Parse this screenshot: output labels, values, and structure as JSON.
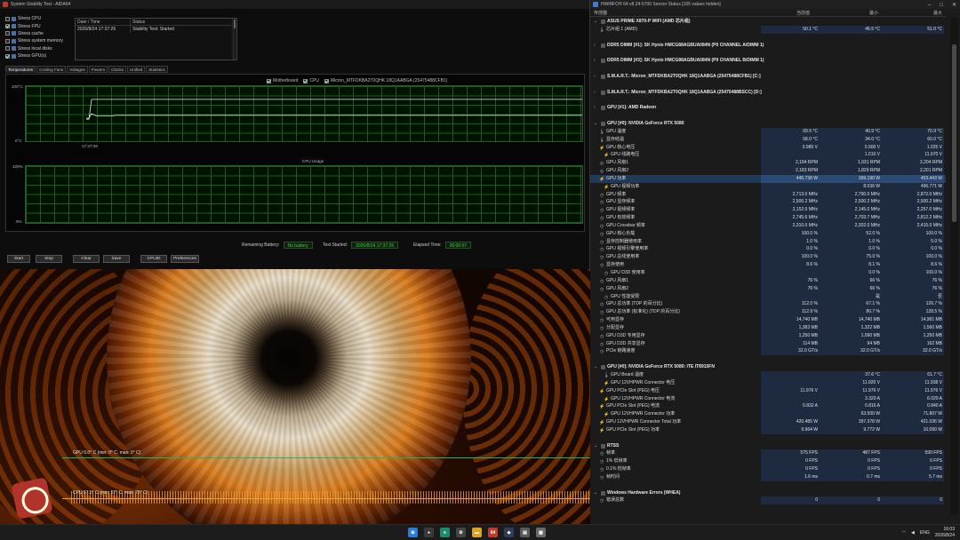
{
  "aida": {
    "title": "System Stability Test - AIDA64",
    "stress_items": [
      {
        "label": "Stress CPU",
        "checked": false
      },
      {
        "label": "Stress FPU",
        "checked": true
      },
      {
        "label": "Stress cache",
        "checked": false
      },
      {
        "label": "Stress system memory",
        "checked": false
      },
      {
        "label": "Stress local disks",
        "checked": false
      },
      {
        "label": "Stress GPU(s)",
        "checked": true
      }
    ],
    "status_table": {
      "col_datetime": "Date / Time",
      "col_status": "Status",
      "row_datetime": "2026/8/24 17:37:26",
      "row_status": "Stability Test: Started"
    },
    "tabs": [
      "Temperatures",
      "Cooling Fans",
      "Voltages",
      "Powers",
      "Clocks",
      "Unified",
      "Statistics"
    ],
    "active_tab": "Temperatures",
    "legend": [
      "Motherboard",
      "CPU",
      "Micron_MTFDKBA2T0QHK 18Q1AABGA (25475488CFB1)"
    ],
    "temp_axis_top": "100°C",
    "temp_axis_bottom": "0°C",
    "temp_time_label": "17:37:26",
    "temperature_series": {
      "note": "relative level per column, 0 = 0°C, 1 = 100°C",
      "line_a": [
        0.42,
        0.42,
        0.5,
        0.46,
        0.46,
        0.46,
        0.46,
        0.47,
        0.47,
        0.47,
        0.47,
        0.47,
        0.47,
        0.47,
        0.47,
        0.47,
        0.47,
        0.47,
        0.47,
        0.47
      ],
      "line_b": [
        0.4,
        0.4,
        0.76,
        0.76,
        0.76,
        0.76,
        0.76,
        0.76,
        0.76,
        0.76,
        0.76,
        0.76,
        0.76,
        0.76,
        0.76,
        0.76,
        0.76,
        0.76,
        0.76,
        0.76
      ]
    },
    "cpu_graph_title": "CPU Usage",
    "cpu_axis_top": "100%",
    "cpu_axis_bottom": "0%",
    "remaining_battery_label": "Remaining Battery:",
    "remaining_battery_value": "No battery",
    "test_started_label": "Test Started:",
    "test_started_value": "2026/8/24 17:37:26",
    "elapsed_label": "Elapsed Time:",
    "elapsed_value": "00:00:07",
    "buttons": {
      "start": "Start",
      "stop": "Stop",
      "clear": "Clear",
      "save": "Save",
      "cpuid": "CPUID",
      "preferences": "Preferences"
    }
  },
  "osd": {
    "gpu_line": "GPU 0.0° C (min: 0° C, max: 0° C)",
    "cpu_line": "CPU 57.0° C (min: 57° C, max: 78° C)"
  },
  "hwinfo": {
    "title": "HWiNFO® 64 v8.24-5700 Sensor Status [105 values hidden]",
    "window_buttons": {
      "minimize": "–",
      "maximize": "□",
      "close": "✕"
    },
    "columns": {
      "sensor": "传感器",
      "current": "当前值",
      "min": "最小",
      "max": "最大"
    },
    "rows": [
      {
        "kind": "group",
        "name": "ASUS PRIME X870-P WIFI (AMD 芯片组)"
      },
      {
        "kind": "sensor",
        "icon": "thermometer",
        "name": "芯片组 1 (AMD)",
        "cur": "50.1 °C",
        "min": "46.5 °C",
        "max": "51.0 °C"
      },
      {
        "kind": "spacer"
      },
      {
        "kind": "group",
        "name": "DDR5 DIMM [#1]: SK Hynix HMCG88AGBUA084N (P0 CHANNEL A/DIMM 1)"
      },
      {
        "kind": "spacer"
      },
      {
        "kind": "group",
        "name": "DDR5 DIMM [#3]: SK Hynix HMCG88AGBUA084N (P0 CHANNEL B/DIMM 1)"
      },
      {
        "kind": "spacer"
      },
      {
        "kind": "group",
        "name": "S.M.A.R.T.: Micron_MTFDKBA2T0QHK 18Q1AABGA (25475488CFB1) [C:]"
      },
      {
        "kind": "spacer"
      },
      {
        "kind": "group",
        "name": "S.M.A.R.T.: Micron_MTFDKBA2T0QHK 18Q1AABGA (25475488BSCC) [D:]"
      },
      {
        "kind": "spacer"
      },
      {
        "kind": "group",
        "name": "GPU [#1]: AMD Radeon"
      },
      {
        "kind": "spacer"
      },
      {
        "kind": "group",
        "name": "GPU [#0]: NVIDIA GeForce RTX 5080"
      },
      {
        "kind": "sensor",
        "icon": "thermometer",
        "name": "GPU 温度",
        "cur": "69.5 °C",
        "min": "40.9 °C",
        "max": "70.9 °C"
      },
      {
        "kind": "sensor",
        "icon": "thermometer",
        "name": "显存结温",
        "cur": "58.0 °C",
        "min": "34.0 °C",
        "max": "60.0 °C"
      },
      {
        "kind": "sensor",
        "icon": "bolt",
        "name": "GPU 核心电压",
        "cur": "0.985 V",
        "min": "0.900 V",
        "max": "1.025 V"
      },
      {
        "kind": "sensor",
        "sub": true,
        "icon": "bolt",
        "name": "GPU 线路电压",
        "cur": "",
        "min": "1.010 V",
        "max": "11.970 V"
      },
      {
        "kind": "sensor",
        "icon": "fan",
        "name": "GPU 风扇1",
        "cur": "2,194 RPM",
        "min": "1,931 RPM",
        "max": "2,204 RPM"
      },
      {
        "kind": "sensor",
        "icon": "fan",
        "name": "GPU 风扇2",
        "cur": "2,183 RPM",
        "min": "1,829 RPM",
        "max": "2,201 RPM"
      },
      {
        "kind": "sensor",
        "icon": "bolt",
        "name": "GPU 功率",
        "cur": "445.738 W",
        "min": "399.190 W",
        "max": "453.443 W",
        "highlight": true
      },
      {
        "kind": "sensor",
        "sub": true,
        "icon": "bolt",
        "name": "GPU 视频功率",
        "cur": "",
        "min": "8.036 W",
        "max": "496.771 W"
      },
      {
        "kind": "sensor",
        "icon": "clock",
        "name": "GPU 频率",
        "cur": "2,713.0 MHz",
        "min": "2,790.0 MHz",
        "max": "2,872.0 MHz"
      },
      {
        "kind": "sensor",
        "icon": "clock",
        "name": "GPU 显存频率",
        "cur": "2,500.2 MHz",
        "min": "2,500.2 MHz",
        "max": "2,500.2 MHz"
      },
      {
        "kind": "sensor",
        "icon": "clock",
        "name": "GPU 视频频率",
        "cur": "2,152.0 MHz",
        "min": "2,145.0 MHz",
        "max": "2,257.0 MHz"
      },
      {
        "kind": "sensor",
        "icon": "clock",
        "name": "GPU 有效频率",
        "cur": "2,745.6 MHz",
        "min": "2,703.7 MHz",
        "max": "2,812.2 MHz"
      },
      {
        "kind": "sensor",
        "icon": "clock",
        "name": "GPU Crossbar 频率",
        "cur": "2,310.0 MHz",
        "min": "2,302.0 MHz",
        "max": "2,415.0 MHz"
      },
      {
        "kind": "sensor",
        "icon": "clock",
        "name": "GPU 核心负载",
        "cur": "100.0 %",
        "min": "52.0 %",
        "max": "100.0 %"
      },
      {
        "kind": "sensor",
        "icon": "clock",
        "name": "显存控制器使用率",
        "cur": "1.0 %",
        "min": "1.0 %",
        "max": "5.0 %"
      },
      {
        "kind": "sensor",
        "icon": "clock",
        "name": "GPU 视频引擎使用率",
        "cur": "0.0 %",
        "min": "0.0 %",
        "max": "0.0 %"
      },
      {
        "kind": "sensor",
        "icon": "clock",
        "name": "GPU 总线使用率",
        "cur": "100.0 %",
        "min": "75.0 %",
        "max": "100.0 %"
      },
      {
        "kind": "sensor",
        "icon": "clock",
        "name": "显存使用",
        "cur": "8.6 %",
        "min": "8.1 %",
        "max": "8.6 %"
      },
      {
        "kind": "sensor",
        "sub": true,
        "icon": "clock",
        "name": "GPU D3D 使用率",
        "cur": "",
        "min": "0.0 %",
        "max": "100.0 %"
      },
      {
        "kind": "sensor",
        "icon": "clock",
        "name": "GPU 风扇1",
        "cur": "76 %",
        "min": "66 %",
        "max": "76 %"
      },
      {
        "kind": "sensor",
        "icon": "clock",
        "name": "GPU 风扇2",
        "cur": "76 %",
        "min": "66 %",
        "max": "76 %"
      },
      {
        "kind": "sensor",
        "sub": true,
        "icon": "clock",
        "name": "GPU 性能受限",
        "cur": "",
        "min": "是",
        "max": "否"
      },
      {
        "kind": "sensor",
        "icon": "clock",
        "name": "GPU 总功率 (TDP 的百分比)",
        "cur": "112.0 %",
        "min": "67.1 %",
        "max": "126.7 %"
      },
      {
        "kind": "sensor",
        "icon": "clock",
        "name": "GPU 总功率 (标准化) (TDP 的百分比)",
        "cur": "112.9 %",
        "min": "80.7 %",
        "max": "128.5 %"
      },
      {
        "kind": "sensor",
        "icon": "clock",
        "name": "可用显存",
        "cur": "14,740 MB",
        "min": "14,740 MB",
        "max": "14,981 MB"
      },
      {
        "kind": "sensor",
        "icon": "clock",
        "name": "分配显存",
        "cur": "1,383 MB",
        "min": "1,322 MB",
        "max": "1,560 MB"
      },
      {
        "kind": "sensor",
        "icon": "clock",
        "name": "GPU D3D 专用显存",
        "cur": "1,250 MB",
        "min": "1,090 MB",
        "max": "1,250 MB"
      },
      {
        "kind": "sensor",
        "icon": "clock",
        "name": "GPU D3D 共享显存",
        "cur": "114 MB",
        "min": "94 MB",
        "max": "162 MB"
      },
      {
        "kind": "sensor",
        "icon": "clock",
        "name": "PCIe 链路速度",
        "cur": "32.0 GT/s",
        "min": "32.0 GT/s",
        "max": "32.0 GT/s"
      },
      {
        "kind": "spacer"
      },
      {
        "kind": "group",
        "name": "GPU [#0]: NVIDIA GeForce RTX 5080: ITE IT8915FN"
      },
      {
        "kind": "sensor",
        "sub": true,
        "icon": "thermometer",
        "name": "GPU Board 温度",
        "cur": "",
        "min": "37.6 °C",
        "max": "61.7 °C"
      },
      {
        "kind": "sensor",
        "sub": true,
        "icon": "bolt",
        "name": "GPU 12VHPWR Connector 电压",
        "cur": "",
        "min": "11.920 V",
        "max": "11.938 V"
      },
      {
        "kind": "sensor",
        "icon": "bolt",
        "name": "GPU PCIe Slot (PEG) 电压",
        "cur": "11.976 V",
        "min": "11.976 V",
        "max": "11.976 V"
      },
      {
        "kind": "sensor",
        "sub": true,
        "icon": "bolt",
        "name": "GPU 12VHPWR Connector 电流",
        "cur": "",
        "min": "3.320 A",
        "max": "6.020 A"
      },
      {
        "kind": "sensor",
        "icon": "bolt",
        "name": "GPU PCIe Slot (PEG) 电流",
        "cur": "0.832 A",
        "min": "0.816 A",
        "max": "0.840 A"
      },
      {
        "kind": "sensor",
        "sub": true,
        "icon": "bolt",
        "name": "GPU 12VHPWR Connector 功率",
        "cur": "",
        "min": "63.500 W",
        "max": "71.807 W"
      },
      {
        "kind": "sensor",
        "icon": "bolt",
        "name": "GPU 12VHPWR Connector Total 功率",
        "cur": "420.485 W",
        "min": "397.378 W",
        "max": "421.036 W"
      },
      {
        "kind": "sensor",
        "icon": "bolt",
        "name": "GPU PCIe Slot (PEG) 功率",
        "cur": "9.964 W",
        "min": "9.772 W",
        "max": "10.090 W"
      },
      {
        "kind": "spacer"
      },
      {
        "kind": "group",
        "name": "RTSS"
      },
      {
        "kind": "sensor",
        "icon": "clock",
        "name": "帧率",
        "cur": "575 FPS",
        "min": "487 FPS",
        "max": "590 FPS"
      },
      {
        "kind": "sensor",
        "icon": "clock",
        "name": "1% 低帧率",
        "cur": "0 FPS",
        "min": "0 FPS",
        "max": "0 FPS"
      },
      {
        "kind": "sensor",
        "icon": "clock",
        "name": "0.1% 低帧率",
        "cur": "0 FPS",
        "min": "0 FPS",
        "max": "0 FPS"
      },
      {
        "kind": "sensor",
        "icon": "clock",
        "name": "帧时间",
        "cur": "1.6 ms",
        "min": "0.7 ms",
        "max": "5.7 ms"
      },
      {
        "kind": "spacer"
      },
      {
        "kind": "group",
        "name": "Windows Hardware Errors (WHEA)"
      },
      {
        "kind": "sensor",
        "icon": "clock",
        "name": "错误总数",
        "cur": "0",
        "min": "0",
        "max": "0"
      }
    ]
  },
  "taskbar": {
    "icons": [
      {
        "name": "windows-start-icon",
        "glyph": "⊞",
        "color": "#2d7dd2"
      },
      {
        "name": "search-icon",
        "glyph": "●",
        "color": "#3a3a3a"
      },
      {
        "name": "edge-icon",
        "glyph": "e",
        "color": "#1f8a70"
      },
      {
        "name": "settings-icon",
        "glyph": "⚙",
        "color": "#444444"
      },
      {
        "name": "explorer-icon",
        "glyph": "▬",
        "color": "#d9a520"
      },
      {
        "name": "aida64-icon",
        "glyph": "64",
        "color": "#c0392b"
      },
      {
        "name": "steam-icon",
        "glyph": "◆",
        "color": "#2a3f5f"
      },
      {
        "name": "hwinfo-icon",
        "glyph": "▤",
        "color": "#5a5a5a"
      },
      {
        "name": "app-icon",
        "glyph": "▦",
        "color": "#6a6a6a"
      }
    ],
    "tray_lang": "ENG",
    "time": "16:03",
    "date": "2026/8/24"
  }
}
